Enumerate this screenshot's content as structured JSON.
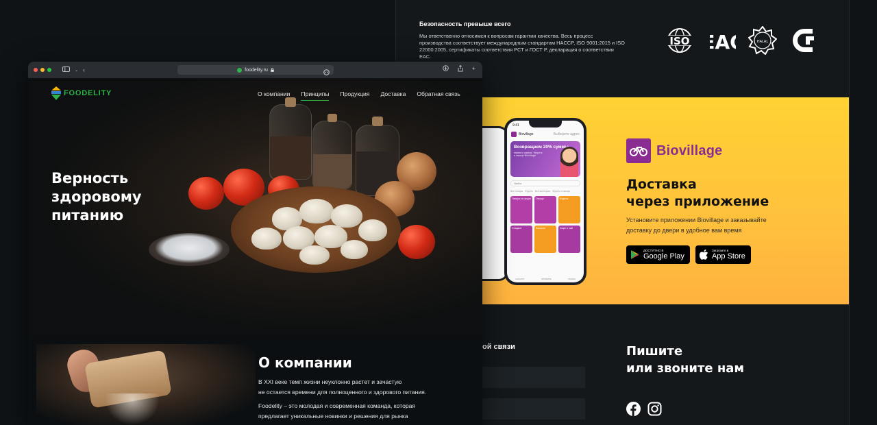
{
  "security": {
    "title": "Безопасность превыше всего",
    "text": "Мы ответственно относимся к вопросам гарантии качества. Весь процесс производства соответствует международным стандартам HACCP, ISO 9001:2015 и ISO 22000:2005, сертификаты соответствия РСТ и ГОСТ Р, декларация о соответствии ЕАС.",
    "certs": [
      "ISO",
      "EAC",
      "HALAL",
      "PCT"
    ]
  },
  "promo": {
    "brand": "Biovillage",
    "title_line1": "Доставка",
    "title_line2": "через приложение",
    "text": "Установите приложении Biovillage и заказывайте доставку до двери в удобное вам время",
    "google_play_sub": "ДОСТУПНО В",
    "google_play_main": "Google Play",
    "app_store_sub": "Загрузите в",
    "app_store_main": "App Store",
    "phone": {
      "time": "9:41",
      "app_name": "Biovillage",
      "location": "Выберите адрес",
      "banner_title": "Возвращаем 20% суммы",
      "banner_sub": "первого заказа. Фрукты и овощи Biovillage",
      "search": "Найти",
      "chips": [
        "Все товары",
        "Фрукты",
        "Все категории",
        "Фрукты и овощи"
      ],
      "tiles": [
        "Товары по акции",
        "Овощи",
        "Фрукты",
        "Сладкое",
        "Бакалея",
        "Кофе и чай"
      ],
      "nav": [
        "КАТАЛОГ",
        "ПРОФИЛЬ",
        "ПОИСК"
      ]
    }
  },
  "contact": {
    "label": "ой связи",
    "write_line1": "Пишите",
    "write_line2": "или звоните нам"
  },
  "browser": {
    "url": "foodelity.ru",
    "colors": {
      "close": "#ff5f57",
      "min": "#febc2e",
      "max": "#28c840"
    }
  },
  "site": {
    "logo": "FOODELITY",
    "menu": [
      "О компании",
      "Принципы",
      "Продукция",
      "Доставка",
      "Обратная связь"
    ],
    "active_menu": "Принципы",
    "hero_line1": "Верность",
    "hero_line2": "здоровому",
    "hero_line3": "питанию",
    "about_title": "О компании",
    "about_p1_line1": "В XXI веке темп жизни неуклонно растет и зачастую",
    "about_p1_line2": "не остается времени для полноценного и здорового питания.",
    "about_p2_line1": "Foodelity – это молодая и современная команда, которая",
    "about_p2_line2": "предлагает уникальные новинки и решения для рынка"
  },
  "colors": {
    "accent": "#2fb34a",
    "brand_purple": "#8a2c91",
    "promo_yellow": "#ffc23c"
  }
}
